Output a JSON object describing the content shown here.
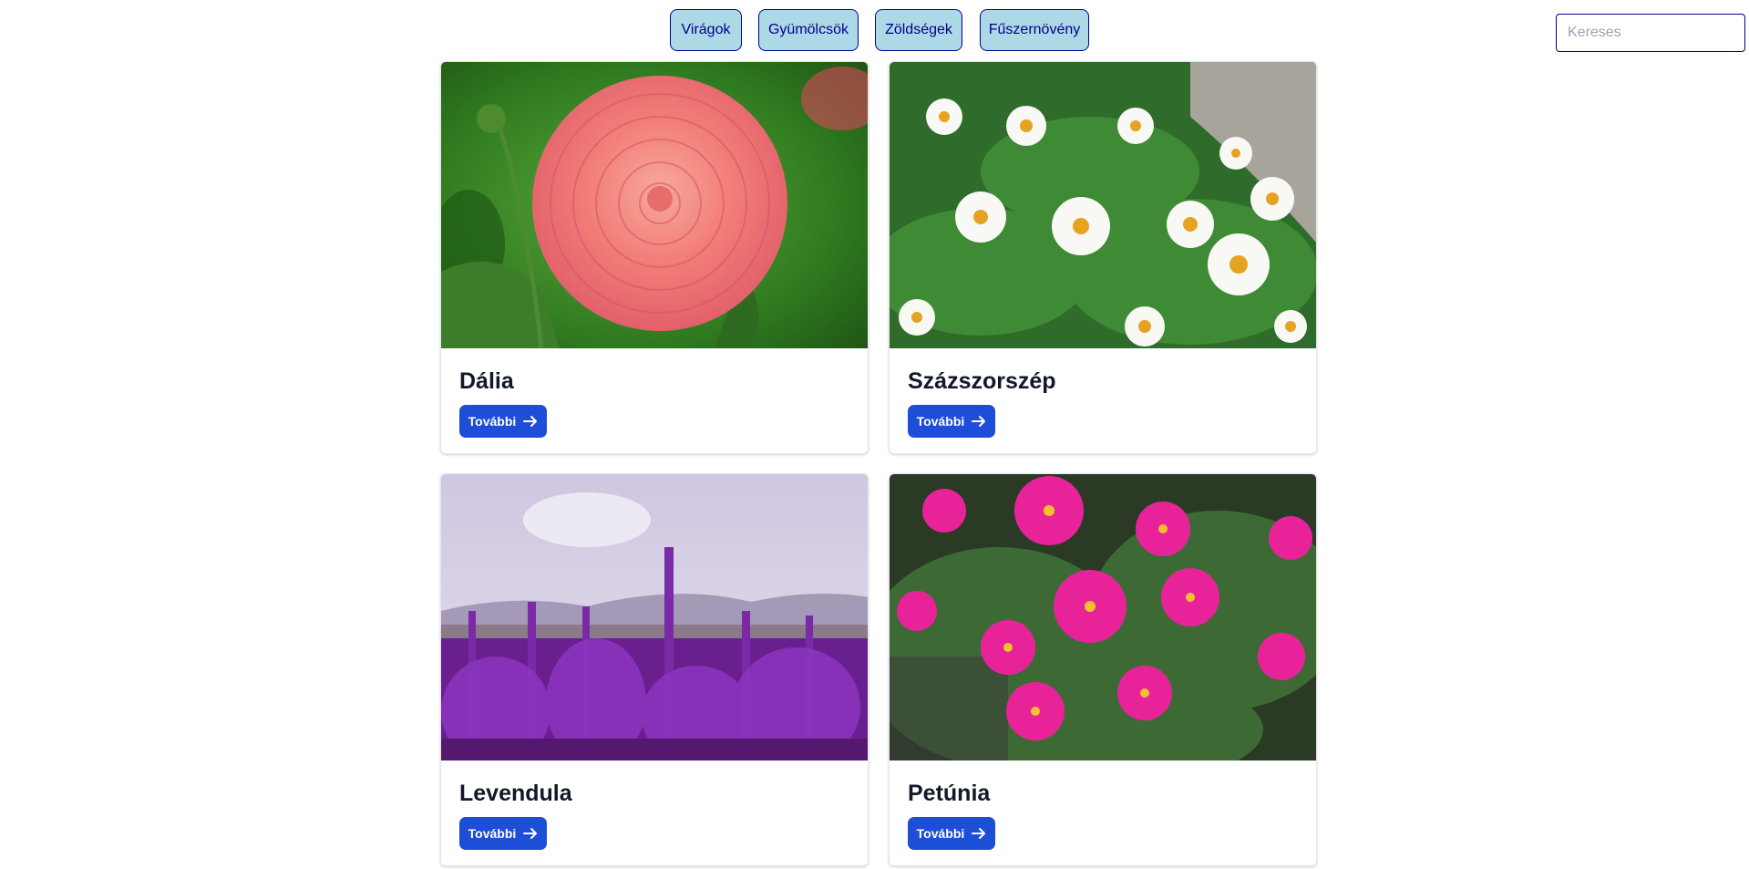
{
  "nav": {
    "items": [
      {
        "label": "Virágok"
      },
      {
        "label": "Gyümölcsök"
      },
      {
        "label": "Zöldségek"
      },
      {
        "label": "Fűszernövény"
      }
    ]
  },
  "search": {
    "placeholder": "Kereses"
  },
  "cards": [
    {
      "title": "Dália",
      "button_label": "További",
      "image": "dahlia-photo"
    },
    {
      "title": "Százszorszép",
      "button_label": "További",
      "image": "daisy-photo"
    },
    {
      "title": "Levendula",
      "button_label": "További",
      "image": "lavender-photo"
    },
    {
      "title": "Petúnia",
      "button_label": "További",
      "image": "petunia-photo"
    }
  ],
  "colors": {
    "nav_bg": "#add8e6",
    "nav_border": "#00008b",
    "button_bg": "#1d4ed8"
  }
}
